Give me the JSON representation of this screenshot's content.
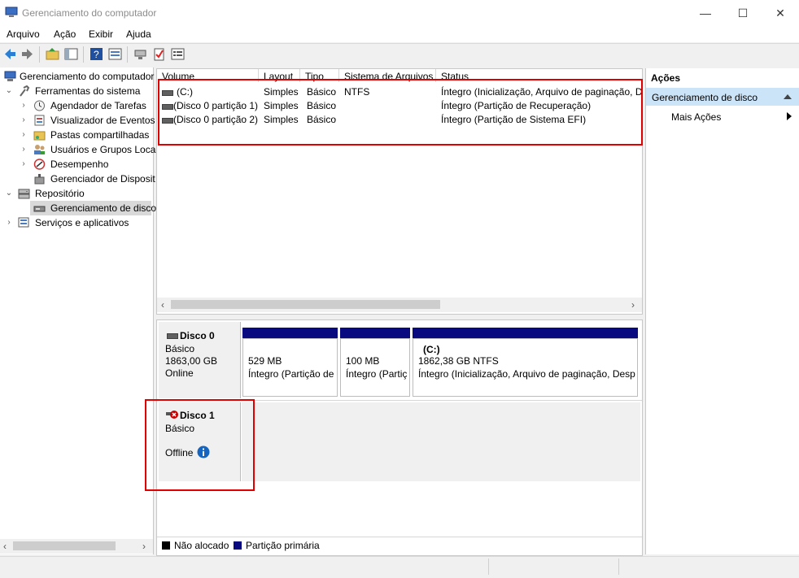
{
  "window": {
    "title": "Gerenciamento do computador",
    "minimize": "—",
    "maximize": "☐",
    "close": "✕"
  },
  "menu": [
    "Arquivo",
    "Ação",
    "Exibir",
    "Ajuda"
  ],
  "tree": {
    "root": "Gerenciamento do computador",
    "system_tools": "Ferramentas do sistema",
    "task_scheduler": "Agendador de Tarefas",
    "event_viewer": "Visualizador de Eventos",
    "shared_folders": "Pastas compartilhadas",
    "local_users": "Usuários e Grupos Loca",
    "performance": "Desempenho",
    "device_manager": "Gerenciador de Disposit",
    "storage": "Repositório",
    "disk_management": "Gerenciamento de disco",
    "services": "Serviços e aplicativos"
  },
  "volume_list": {
    "columns": [
      "Volume",
      "Layout",
      "Tipo",
      "Sistema de Arquivos",
      "Status"
    ],
    "rows": [
      {
        "volume": "(C:)",
        "layout": "Simples",
        "type": "Básico",
        "fs": "NTFS",
        "status": "Íntegro (Inicialização, Arquivo de paginação, D"
      },
      {
        "volume": "(Disco 0 partição 1)",
        "layout": "Simples",
        "type": "Básico",
        "fs": "",
        "status": "Íntegro (Partição de Recuperação)"
      },
      {
        "volume": "(Disco 0 partição 2)",
        "layout": "Simples",
        "type": "Básico",
        "fs": "",
        "status": "Íntegro (Partição de Sistema EFI)"
      }
    ]
  },
  "disks": {
    "disk0": {
      "name": "Disco 0",
      "type": "Básico",
      "size": "1863,00 GB",
      "state": "Online",
      "partitions": [
        {
          "title": "",
          "size": "529 MB",
          "status": "Íntegro (Partição de"
        },
        {
          "title": "",
          "size": "100 MB",
          "status": "Íntegro (Partiç"
        },
        {
          "title": "(C:)",
          "size": "1862,38 GB NTFS",
          "status": "Íntegro (Inicialização, Arquivo de paginação, Desp"
        }
      ]
    },
    "disk1": {
      "name": "Disco 1",
      "type": "Básico",
      "state": "Offline"
    }
  },
  "legend": {
    "unallocated": "Não alocado",
    "primary": "Partição primária"
  },
  "actions": {
    "header": "Ações",
    "section": "Gerenciamento de disco",
    "more": "Mais Ações"
  },
  "colors": {
    "partition_bar": "#0a0a80",
    "highlight_box": "#e00000",
    "action_section": "#cce4f7"
  }
}
